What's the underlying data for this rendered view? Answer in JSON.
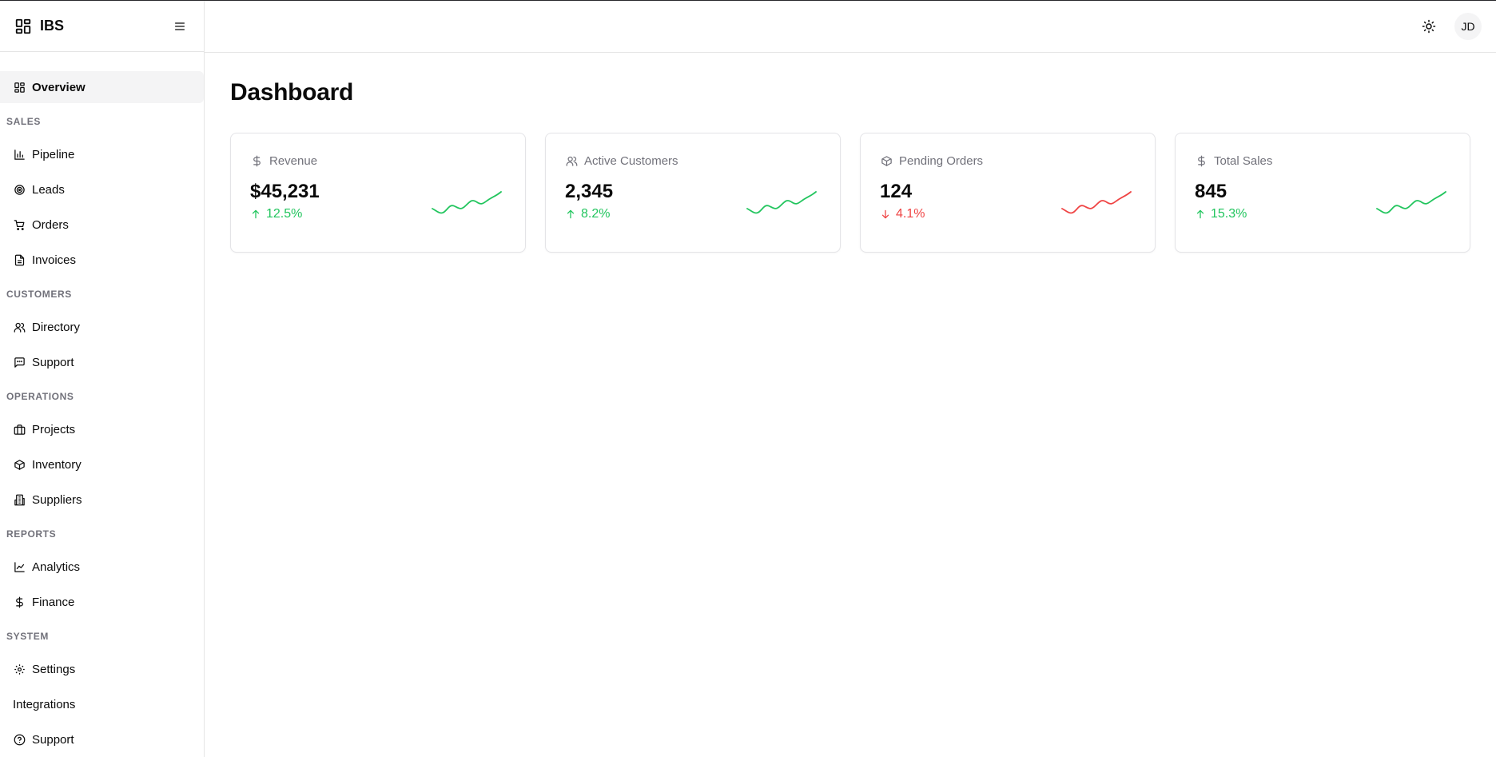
{
  "brand": {
    "name": "IBS"
  },
  "sidebar": {
    "overview": {
      "label": "Overview",
      "icon": "layout-grid-icon"
    },
    "sections": [
      {
        "label": "SALES",
        "items": [
          {
            "label": "Pipeline",
            "icon": "bar-chart-icon"
          },
          {
            "label": "Leads",
            "icon": "target-icon"
          },
          {
            "label": "Orders",
            "icon": "shopping-cart-icon"
          },
          {
            "label": "Invoices",
            "icon": "file-text-icon"
          }
        ]
      },
      {
        "label": "CUSTOMERS",
        "items": [
          {
            "label": "Directory",
            "icon": "users-icon"
          },
          {
            "label": "Support",
            "icon": "message-square-icon"
          }
        ]
      },
      {
        "label": "OPERATIONS",
        "items": [
          {
            "label": "Projects",
            "icon": "briefcase-icon"
          },
          {
            "label": "Inventory",
            "icon": "package-icon"
          },
          {
            "label": "Suppliers",
            "icon": "building-icon"
          }
        ]
      },
      {
        "label": "REPORTS",
        "items": [
          {
            "label": "Analytics",
            "icon": "line-chart-icon"
          },
          {
            "label": "Finance",
            "icon": "dollar-icon"
          }
        ]
      },
      {
        "label": "SYSTEM",
        "items": [
          {
            "label": "Settings",
            "icon": "gear-icon"
          },
          {
            "label": "Integrations",
            "icon": ""
          },
          {
            "label": "Support",
            "icon": "help-circle-icon"
          }
        ]
      }
    ]
  },
  "header": {
    "avatar_initials": "JD",
    "theme_icon": "sun-icon"
  },
  "page": {
    "title": "Dashboard"
  },
  "cards": [
    {
      "label": "Revenue",
      "icon": "dollar-icon",
      "value": "$45,231",
      "change": "12.5%",
      "direction": "up",
      "color": "#22c55e"
    },
    {
      "label": "Active Customers",
      "icon": "users-icon",
      "value": "2,345",
      "change": "8.2%",
      "direction": "up",
      "color": "#22c55e"
    },
    {
      "label": "Pending Orders",
      "icon": "package-icon",
      "value": "124",
      "change": "4.1%",
      "direction": "down",
      "color": "#ef4444"
    },
    {
      "label": "Total Sales",
      "icon": "dollar-icon",
      "value": "845",
      "change": "15.3%",
      "direction": "up",
      "color": "#22c55e"
    }
  ]
}
